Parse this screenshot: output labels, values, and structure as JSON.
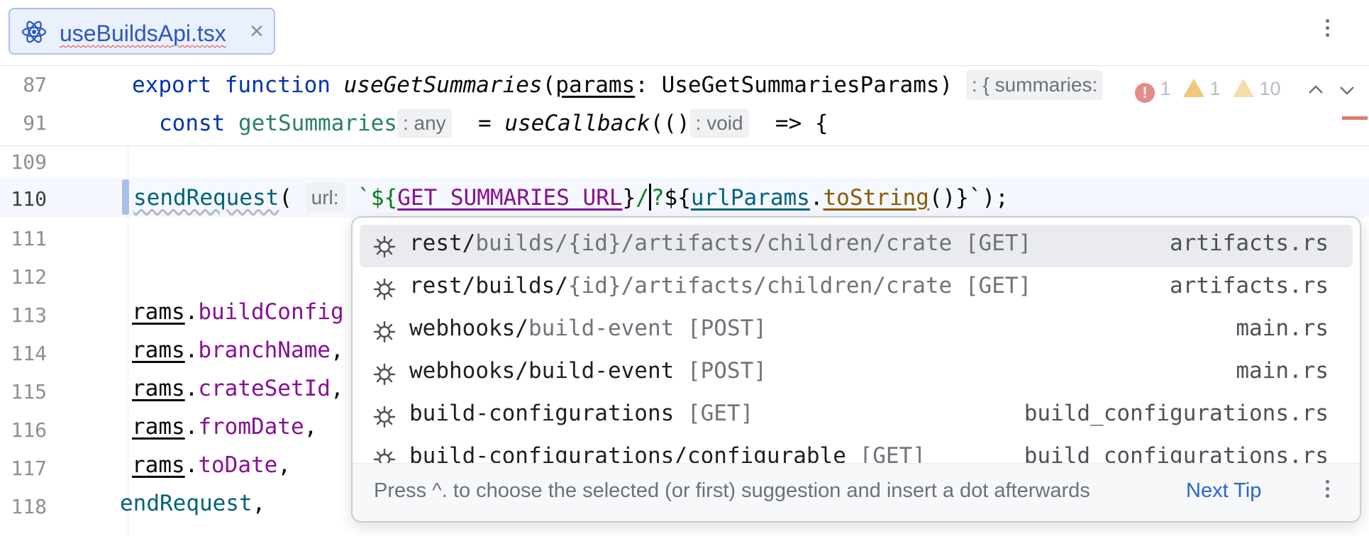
{
  "tab": {
    "file_name": "useBuildsApi.tsx",
    "close_glyph": "×",
    "icon": "react-icon"
  },
  "sticky": [
    {
      "line": "87",
      "kw1": "export",
      "kw2": "function",
      "fn": "useGetSummaries",
      "paren_open": "(",
      "param": "params",
      "rest": ": UseGetSummariesParams)",
      "hint": ": { summaries:"
    },
    {
      "line": "91",
      "kw": "const",
      "var": "getSummaries",
      "hint1": ": any",
      "eq": "= ",
      "fn": "useCallback",
      "p": "(()",
      "hint2": ": void",
      "arrow": "=> {"
    }
  ],
  "inspection": {
    "errors": "1",
    "warnings": "1",
    "weak_warnings": "10"
  },
  "lines": [
    {
      "num": "109"
    },
    {
      "num": "110",
      "fn": "sendRequest",
      "paren": "(",
      "hint": "url:",
      "tick": "`${",
      "const": "GET_SUMMARIES_URL",
      "close": "}",
      "slash": "/",
      "q": "?",
      "tmpl": "${",
      "obj": "urlParams",
      "dot": ".",
      "method": "toString",
      "call": "()",
      "end": "}`);"
    },
    {
      "num": "111"
    },
    {
      "num": "112"
    },
    {
      "num": "113",
      "prefix": "rams",
      "dot": ".",
      "prop": "buildConfig"
    },
    {
      "num": "114",
      "prefix": "rams",
      "dot": ".",
      "prop": "branchName",
      "trail": ","
    },
    {
      "num": "115",
      "prefix": "rams",
      "dot": ".",
      "prop": "crateSetId",
      "trail": ","
    },
    {
      "num": "116",
      "prefix": "rams",
      "dot": ".",
      "prop": "fromDate",
      "trail": ","
    },
    {
      "num": "117",
      "prefix": "rams",
      "dot": ".",
      "prop": "toDate",
      "trail": ","
    },
    {
      "num": "118",
      "text": "endRequest",
      "trail": ","
    }
  ],
  "completion": {
    "items": [
      {
        "main": "rest/",
        "dim": "builds/{id}/artifacts/children/crate [GET]",
        "file": "artifacts.rs",
        "selected": true
      },
      {
        "main": "rest/builds/",
        "dim": "{id}/artifacts/children/crate [GET]",
        "file": "artifacts.rs"
      },
      {
        "main": "webhooks/",
        "dim": "build-event [POST]",
        "file": "main.rs"
      },
      {
        "main": "webhooks/build-event",
        "dim": " [POST]",
        "file": "main.rs"
      },
      {
        "main": "build-configurations",
        "dim": " [GET]",
        "file": "build_configurations.rs"
      },
      {
        "main": "build-configurations/configurable",
        "dim": " [GET]",
        "file": "build_configurations.rs"
      }
    ],
    "footer_tip": "Press ^. to choose the selected (or first) suggestion and insert a dot afterwards",
    "next_tip": "Next Tip"
  }
}
